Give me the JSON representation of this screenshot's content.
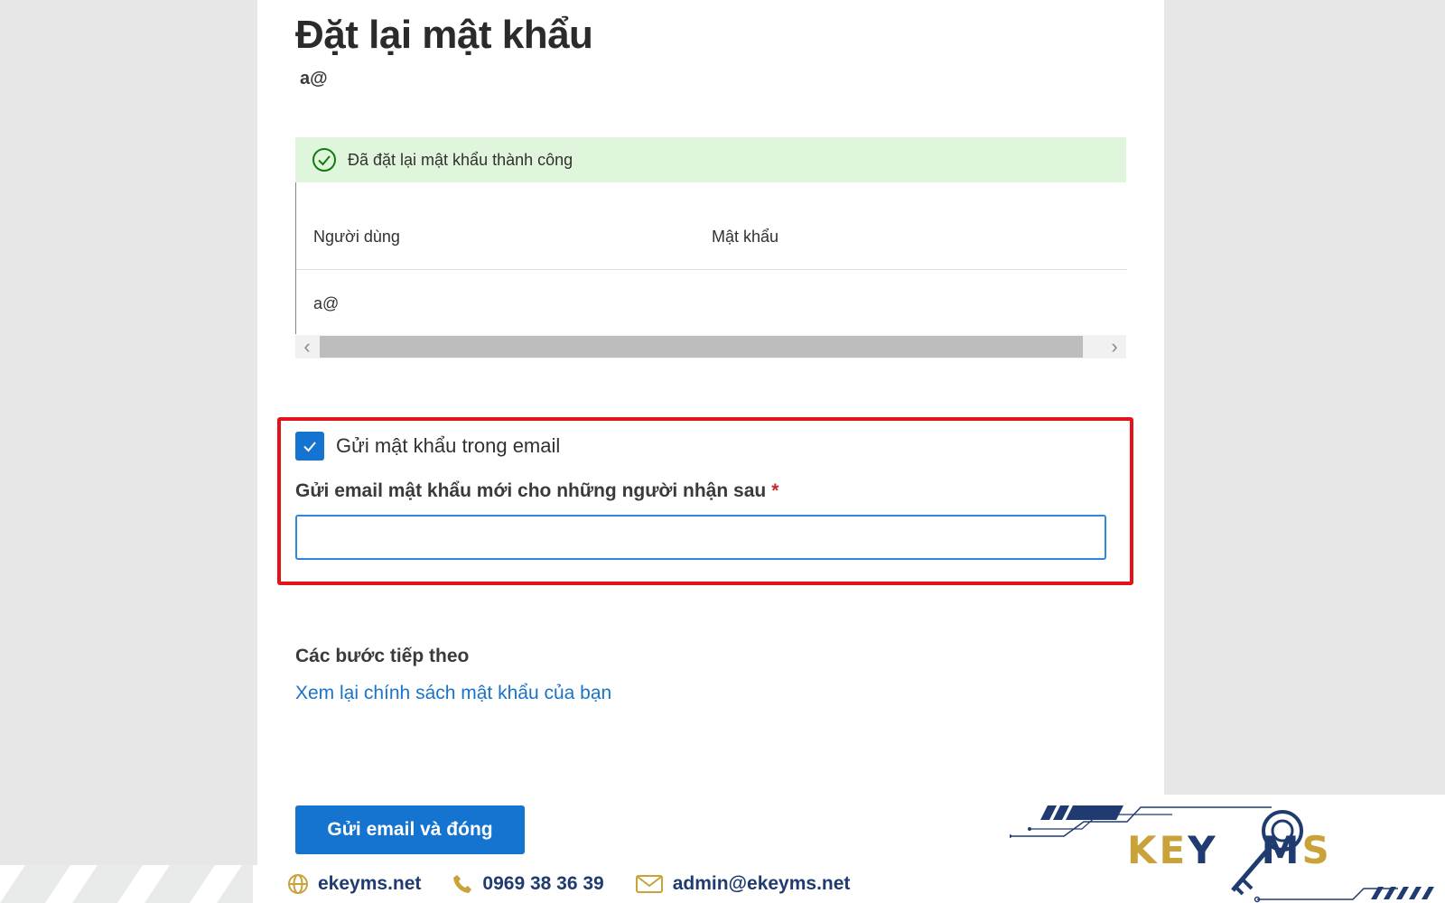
{
  "page": {
    "title": "Đặt lại mật khẩu",
    "subtitle": "a@"
  },
  "success": {
    "message": "Đã đặt lại mật khẩu thành công",
    "color": "#dff6dd",
    "icon": "check-circle-icon"
  },
  "table": {
    "columns": [
      "Người dùng",
      "Mật khẩu"
    ],
    "rows": [
      {
        "user": "a@",
        "password": ""
      }
    ]
  },
  "email_option": {
    "checkbox_label": "Gửi mật khẩu trong email",
    "checked": true,
    "field_label": "Gửi email mật khẩu mới cho những người nhận sau",
    "required_mark": "*",
    "value": ""
  },
  "next_steps": {
    "title": "Các bước tiếp theo",
    "link": "Xem lại chính sách mật khẩu của bạn"
  },
  "actions": {
    "primary": "Gửi email và đóng"
  },
  "footer": {
    "website": "ekeyms.net",
    "phone": "0969 38 36 39",
    "email": "admin@ekeyms.net"
  },
  "brand": {
    "logo_text": "KEYMS",
    "primary_color": "#1f3b70",
    "accent_color": "#c9a23a",
    "highlight_color": "#e4121b"
  }
}
